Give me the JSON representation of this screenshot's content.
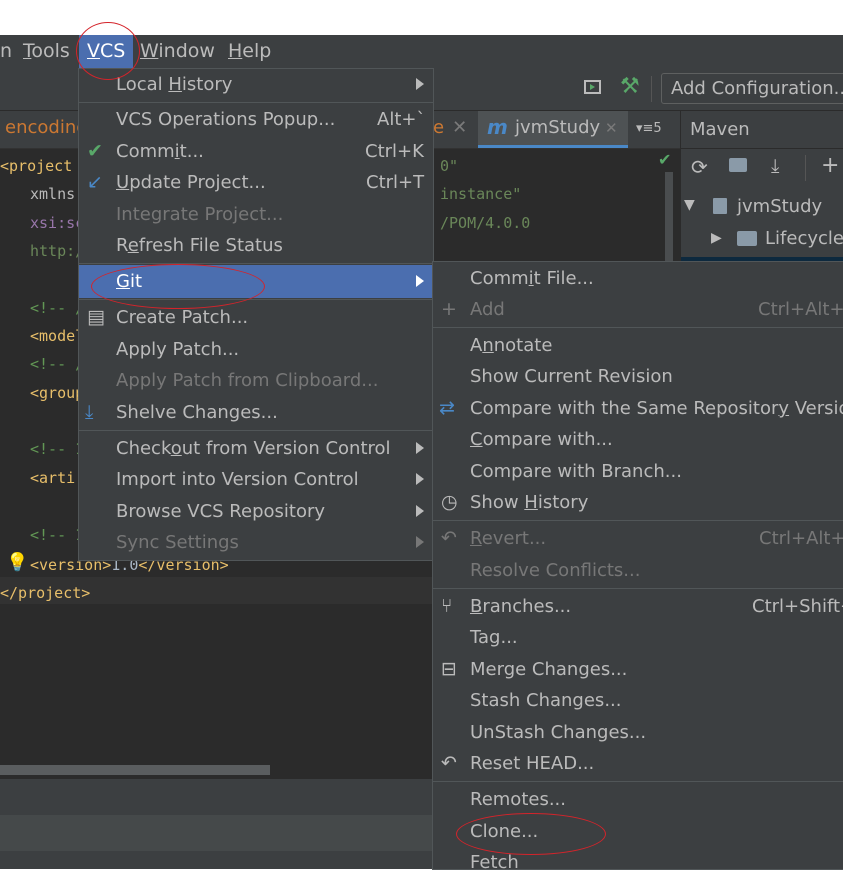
{
  "menubar": {
    "items": [
      {
        "label": "n"
      },
      {
        "label": "Tools",
        "mnemonic": "T",
        "rest": "ools"
      },
      {
        "label": "VCS",
        "mnemonic": "V",
        "rest": "CS"
      },
      {
        "label": "Window",
        "mnemonic": "W",
        "rest": "indow"
      },
      {
        "label": "Help",
        "mnemonic": "H",
        "rest": "elp"
      }
    ]
  },
  "toolbar": {
    "add_configuration": "Add Configuration..."
  },
  "editor": {
    "tab_left": "encoding",
    "tab_mid_fragment": "e",
    "tab_active": "jvmStudy",
    "tab_overflow": "5",
    "lines": {
      "project_open": "<project x",
      "xmlns": "xmlns:",
      "xsi": "xsi:sc",
      "http": "http:/",
      "c1": "<!-- /",
      "model": "<model",
      "c2": "<!-- /",
      "group": "<group",
      "c3": "<!-- 1",
      "arti": "<arti",
      "c4": "<!-- 1",
      "version_open": "<version>",
      "version_value": "1.0",
      "version_close": "</version>",
      "project_close": "</project>",
      "r1": "0\"",
      "r2": "instance\"",
      "r3": "/POM/4.0.0"
    }
  },
  "maven": {
    "title": "Maven",
    "project": "jvmStudy",
    "lifecycle": "Lifecycle"
  },
  "vcs_menu": {
    "items": [
      {
        "pre": "Local ",
        "mn": "H",
        "post": "istory",
        "submenu": true
      },
      {
        "pre": "VCS Operations Popup...",
        "mn": "",
        "post": "",
        "shortcut": "Alt+`"
      },
      {
        "pre": "Comm",
        "mn": "i",
        "post": "t...",
        "shortcut": "Ctrl+K"
      },
      {
        "pre": "",
        "mn": "U",
        "post": "pdate Project...",
        "shortcut": "Ctrl+T"
      },
      {
        "pre": "Integrate Project...",
        "mn": "",
        "post": "",
        "disabled": true
      },
      {
        "pre": "R",
        "mn": "e",
        "post": "fresh File Status"
      },
      {
        "pre": "",
        "mn": "G",
        "post": "it",
        "submenu": true,
        "selected": true
      },
      {
        "pre": "Create Patch...",
        "mn": "",
        "post": ""
      },
      {
        "pre": "Apply Patch...",
        "mn": "",
        "post": ""
      },
      {
        "pre": "Apply Patch from Clipboard...",
        "mn": "",
        "post": "",
        "disabled": true
      },
      {
        "pre": "Shelve Changes...",
        "mn": "",
        "post": ""
      },
      {
        "pre": "Check",
        "mn": "o",
        "post": "ut from Version Control",
        "submenu": true
      },
      {
        "pre": "Import into Version Control",
        "mn": "",
        "post": "",
        "submenu": true
      },
      {
        "pre": "Browse VCS Repository",
        "mn": "",
        "post": "",
        "submenu": true
      },
      {
        "pre": "Sync Settings",
        "mn": "",
        "post": "",
        "submenu": true,
        "disabled": true
      }
    ]
  },
  "git_menu": {
    "items": [
      {
        "pre": "Comm",
        "mn": "i",
        "post": "t File..."
      },
      {
        "pre": "Add",
        "mn": "",
        "post": "",
        "shortcut": "Ctrl+Alt+A",
        "disabled": true
      },
      {
        "pre": "A",
        "mn": "n",
        "post": "notate"
      },
      {
        "pre": "Show Current Revision",
        "mn": "",
        "post": ""
      },
      {
        "pre": "Compare with the Same Repositor",
        "mn": "y",
        "post": " Version"
      },
      {
        "pre": "",
        "mn": "C",
        "post": "ompare with..."
      },
      {
        "pre": "Compare with Branch...",
        "mn": "",
        "post": ""
      },
      {
        "pre": "Show ",
        "mn": "H",
        "post": "istory"
      },
      {
        "pre": "",
        "mn": "R",
        "post": "evert...",
        "shortcut": "Ctrl+Alt+Z",
        "disabled": true
      },
      {
        "pre": "Resolve Conflicts...",
        "mn": "",
        "post": "",
        "disabled": true
      },
      {
        "pre": "",
        "mn": "B",
        "post": "ranches...",
        "shortcut": "Ctrl+Shift+`"
      },
      {
        "pre": "Tag...",
        "mn": "",
        "post": ""
      },
      {
        "pre": "Merge Changes...",
        "mn": "",
        "post": ""
      },
      {
        "pre": "Stash Changes...",
        "mn": "",
        "post": ""
      },
      {
        "pre": "UnStash Changes...",
        "mn": "",
        "post": ""
      },
      {
        "pre": "Reset HEAD...",
        "mn": "",
        "post": ""
      },
      {
        "pre": "Remotes...",
        "mn": "",
        "post": ""
      },
      {
        "pre": "Clone...",
        "mn": "",
        "post": ""
      },
      {
        "pre": "Fetch",
        "mn": "",
        "post": ""
      }
    ]
  },
  "colors": {
    "accent": "#4b6eaf",
    "annotation": "#d4242b",
    "check": "#59a869"
  }
}
